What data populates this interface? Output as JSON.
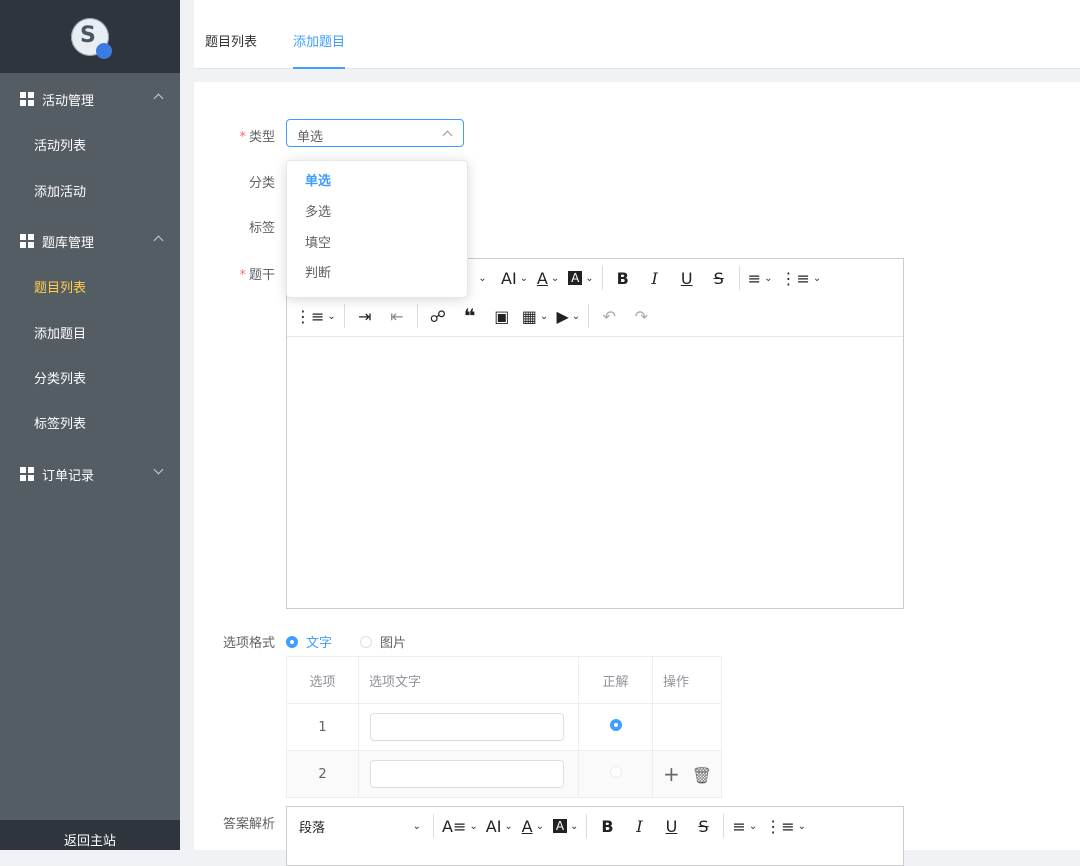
{
  "sidebar": {
    "logo_glyph": "S",
    "groups": [
      {
        "label": "活动管理",
        "expanded": true
      },
      {
        "label": "题库管理",
        "expanded": true
      },
      {
        "label": "订单记录",
        "expanded": false
      }
    ],
    "items": [
      {
        "label": "活动列表"
      },
      {
        "label": "添加活动"
      },
      {
        "label": "题目列表",
        "active": true
      },
      {
        "label": "添加题目"
      },
      {
        "label": "分类列表"
      },
      {
        "label": "标签列表"
      }
    ],
    "back_home": "返回主站",
    "active_color": "#ffd04b"
  },
  "tabs": [
    {
      "label": "题目列表"
    },
    {
      "label": "添加题目",
      "active": true
    }
  ],
  "form": {
    "type_label": "类型",
    "category_label": "分类",
    "tag_label": "标签",
    "stem_label": "题干",
    "type_value": "单选",
    "type_options": [
      "单选",
      "多选",
      "填空",
      "判断"
    ],
    "option_format_label": "选项格式",
    "format_options": [
      {
        "label": "文字",
        "checked": true
      },
      {
        "label": "图片",
        "checked": false
      }
    ],
    "analysis_label": "答案解析",
    "paragraph_select": "段落"
  },
  "options_table": {
    "headers": [
      "选项",
      "选项文字",
      "正解",
      "操作"
    ],
    "rows": [
      {
        "index": "1",
        "correct": true
      },
      {
        "index": "2",
        "correct": false
      }
    ]
  },
  "accent_color": "#409eff"
}
